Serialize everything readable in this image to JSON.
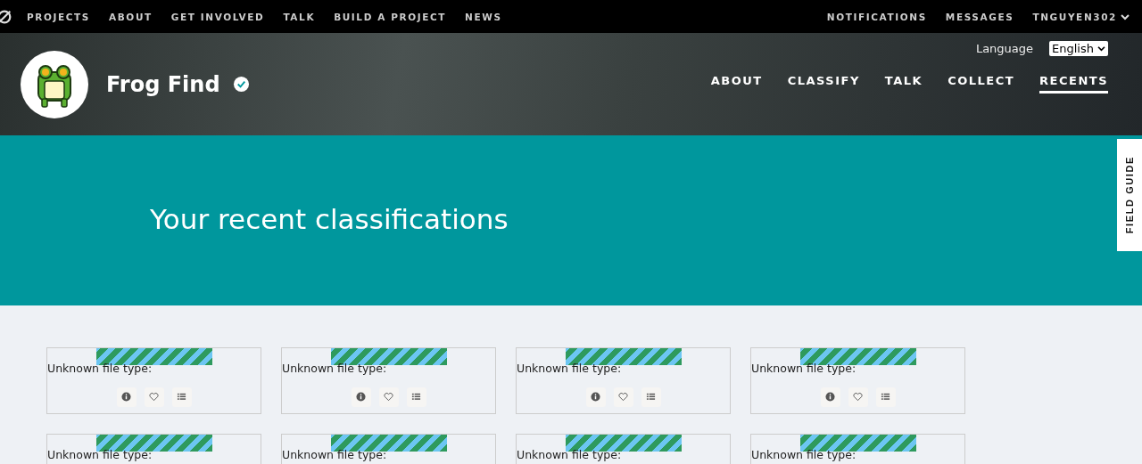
{
  "top_nav": {
    "left": [
      "PROJECTS",
      "ABOUT",
      "GET INVOLVED",
      "TALK",
      "BUILD A PROJECT",
      "NEWS"
    ],
    "right": [
      "NOTIFICATIONS",
      "MESSAGES"
    ],
    "user": "TNGUYEN302"
  },
  "project_header": {
    "title": "Frog Find",
    "verified": true,
    "language_label": "Language",
    "language_value": "English",
    "tabs": [
      {
        "label": "ABOUT",
        "selected": false
      },
      {
        "label": "CLASSIFY",
        "selected": false
      },
      {
        "label": "TALK",
        "selected": false
      },
      {
        "label": "COLLECT",
        "selected": false
      },
      {
        "label": "RECENTS",
        "selected": true
      }
    ]
  },
  "hero": {
    "heading": "Your recent classifications"
  },
  "field_guide": "FIELD GUIDE",
  "classifications": [
    {
      "message": "Unknown file type:"
    },
    {
      "message": "Unknown file type:"
    },
    {
      "message": "Unknown file type:"
    },
    {
      "message": "Unknown file type:"
    },
    {
      "message": "Unknown file type:"
    },
    {
      "message": "Unknown file type:"
    },
    {
      "message": "Unknown file type:"
    },
    {
      "message": "Unknown file type:"
    }
  ]
}
